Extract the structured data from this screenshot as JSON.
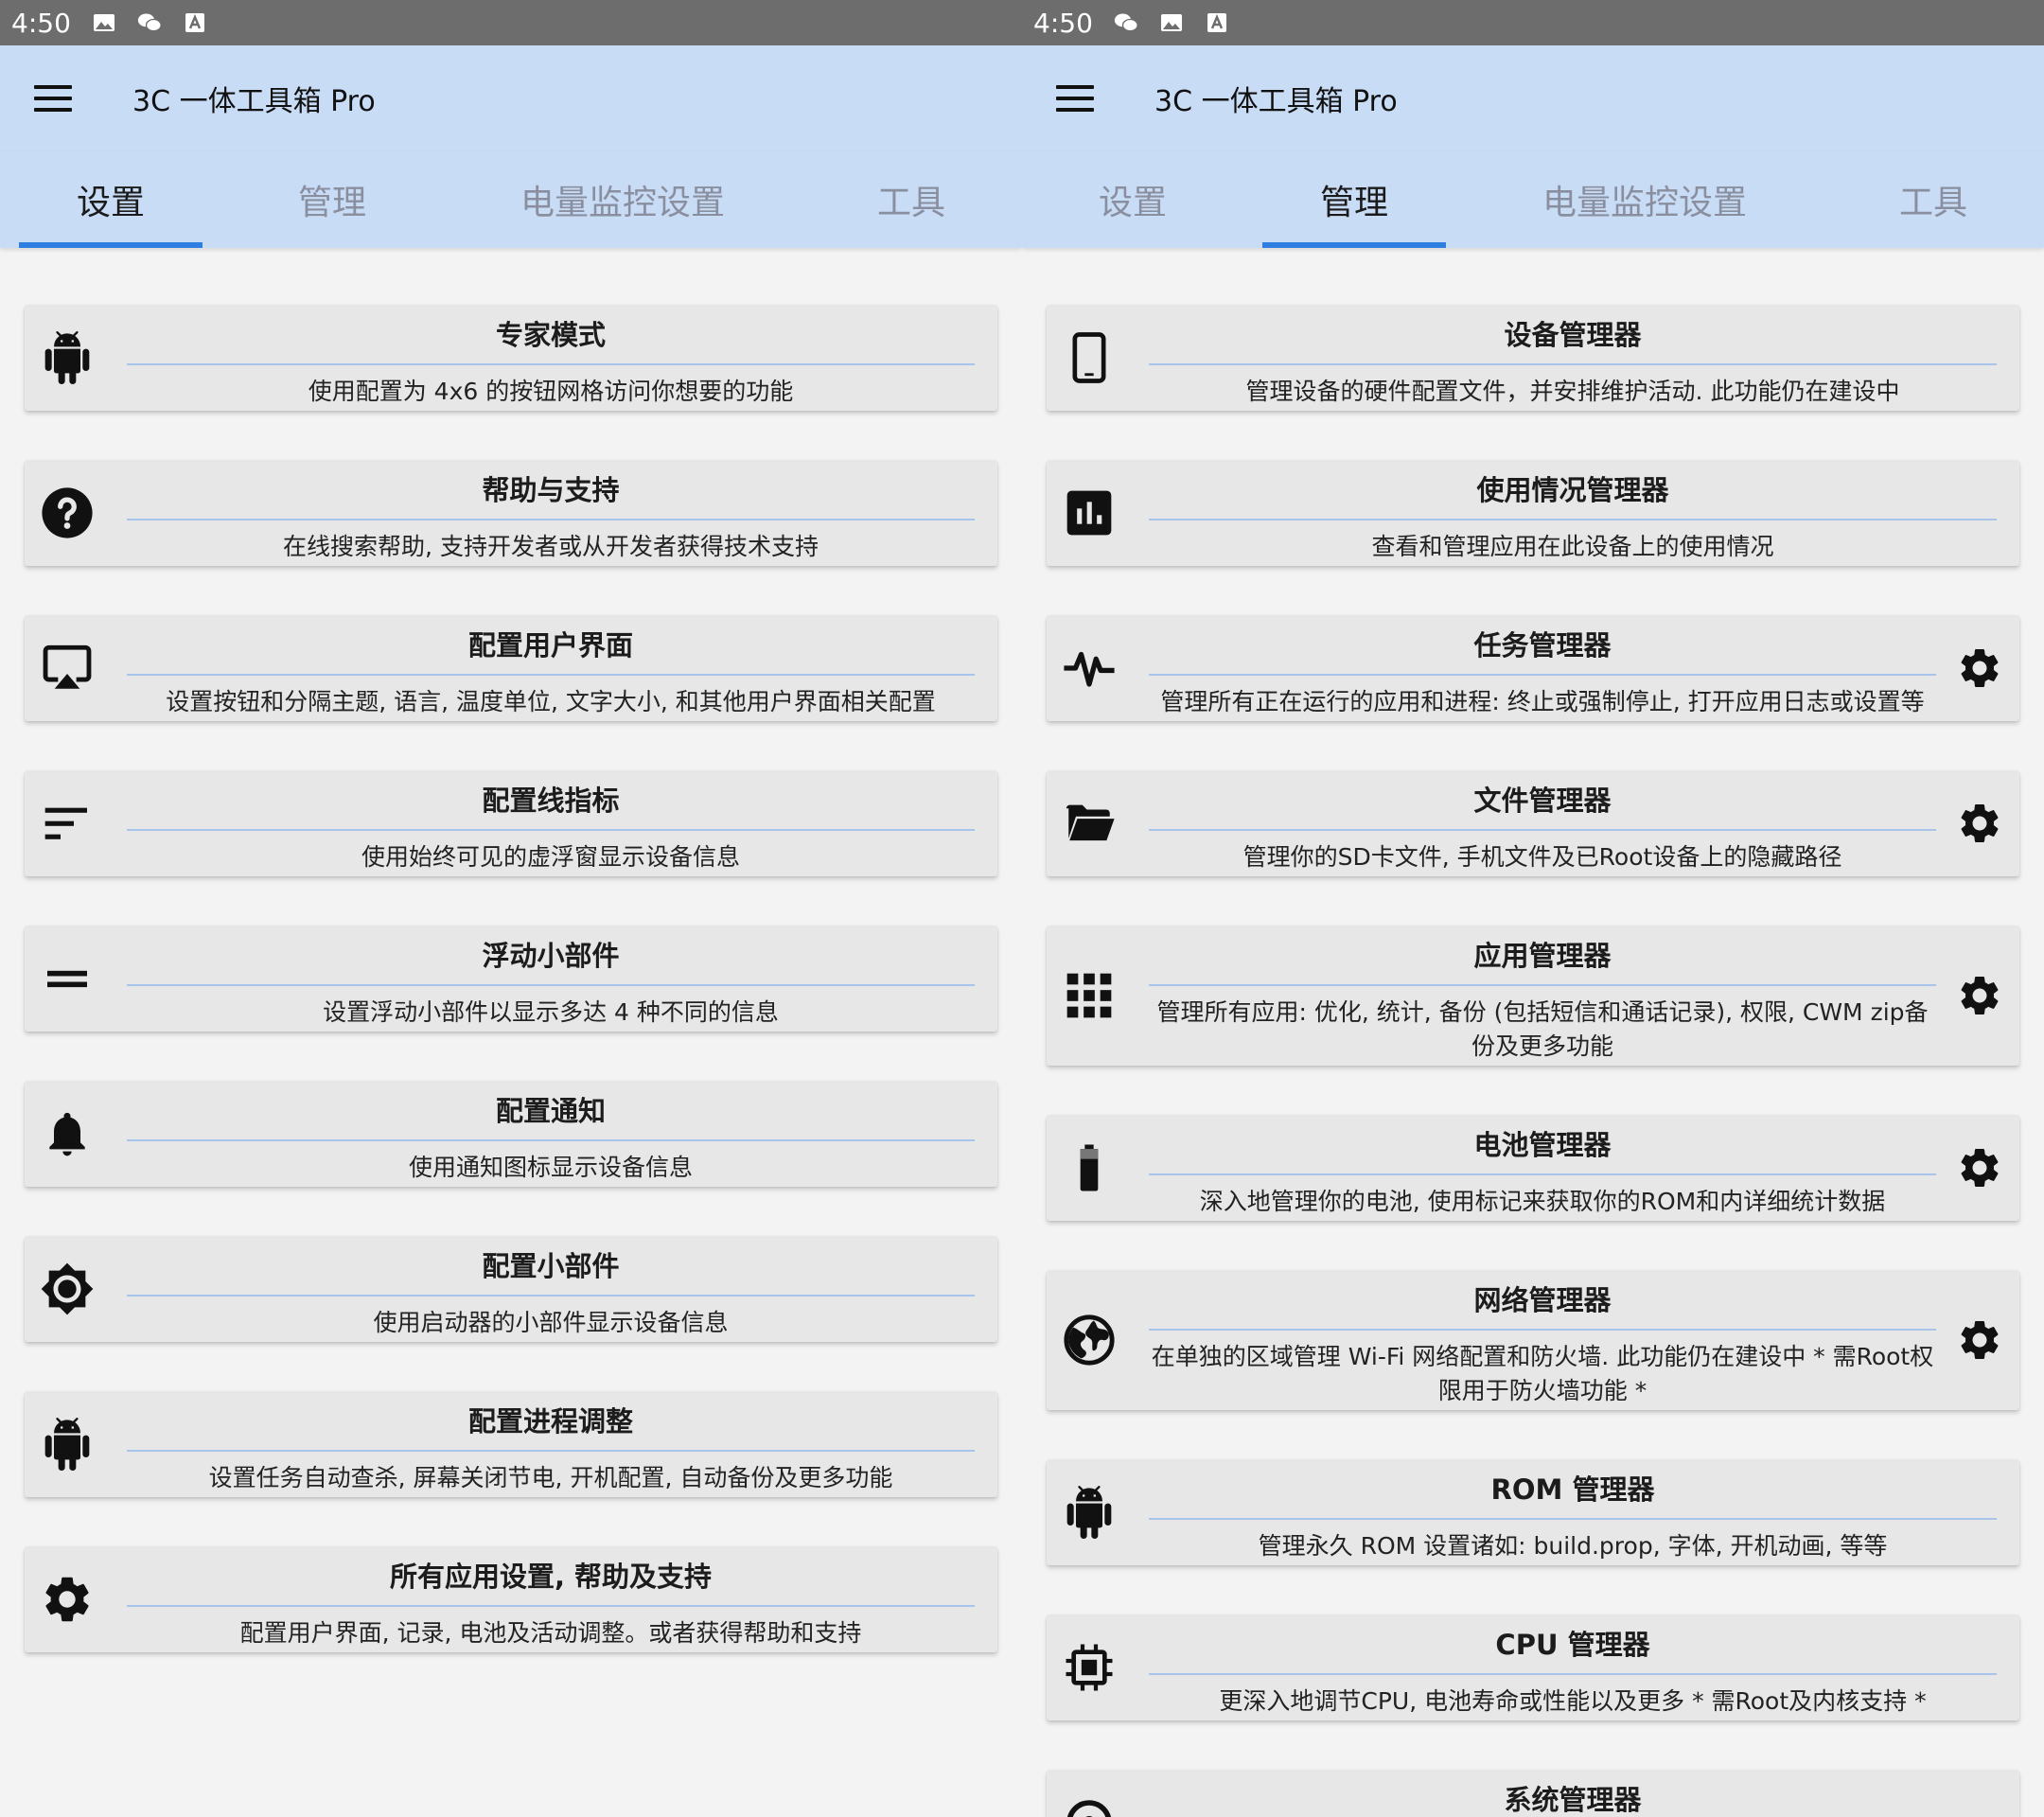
{
  "left": {
    "status": {
      "time": "4:50"
    },
    "appbar": {
      "title": "3C 一体工具箱 Pro"
    },
    "tabs": [
      {
        "label": "设置",
        "active": true
      },
      {
        "label": "管理",
        "active": false
      },
      {
        "label": "电量监控设置",
        "active": false
      },
      {
        "label": "工具",
        "active": false
      }
    ],
    "items": [
      {
        "icon": "android-icon",
        "title": "专家模式",
        "desc": "使用配置为 4x6 的按钮网格访问你想要的功能"
      },
      {
        "icon": "help-icon",
        "title": "帮助与支持",
        "desc": "在线搜索帮助, 支持开发者或从开发者获得技术支持"
      },
      {
        "icon": "cast-screen-icon",
        "title": "配置用户界面",
        "desc": "设置按钮和分隔主题, 语言, 温度单位, 文字大小, 和其他用户界面相关配置"
      },
      {
        "icon": "sort-lines-icon",
        "title": "配置线指标",
        "desc": "使用始终可见的虚浮窗显示设备信息"
      },
      {
        "icon": "equals-icon",
        "title": "浮动小部件",
        "desc": "设置浮动小部件以显示多达 4 种不同的信息"
      },
      {
        "icon": "bell-icon",
        "title": "配置通知",
        "desc": "使用通知图标显示设备信息"
      },
      {
        "icon": "brightness-icon",
        "title": "配置小部件",
        "desc": "使用启动器的小部件显示设备信息"
      },
      {
        "icon": "android-icon",
        "title": "配置进程调整",
        "desc": "设置任务自动查杀, 屏幕关闭节电, 开机配置, 自动备份及更多功能"
      },
      {
        "icon": "gear-icon",
        "title": "所有应用设置, 帮助及支持",
        "desc": "配置用户界面, 记录, 电池及活动调整。或者获得帮助和支持"
      }
    ]
  },
  "right": {
    "status": {
      "time": "4:50"
    },
    "appbar": {
      "title": "3C 一体工具箱 Pro"
    },
    "tabs": [
      {
        "label": "设置",
        "active": false
      },
      {
        "label": "管理",
        "active": true
      },
      {
        "label": "电量监控设置",
        "active": false
      },
      {
        "label": "工具",
        "active": false
      }
    ],
    "items": [
      {
        "icon": "phone-icon",
        "title": "设备管理器",
        "desc": "管理设备的硬件配置文件，并安排维护活动. 此功能仍在建设中",
        "gear": false
      },
      {
        "icon": "bar-chart-icon",
        "title": "使用情况管理器",
        "desc": "查看和管理应用在此设备上的使用情况",
        "gear": false
      },
      {
        "icon": "pulse-icon",
        "title": "任务管理器",
        "desc": "管理所有正在运行的应用和进程: 终止或强制停止, 打开应用日志或设置等",
        "gear": true
      },
      {
        "icon": "folder-open-icon",
        "title": "文件管理器",
        "desc": "管理你的SD卡文件, 手机文件及已Root设备上的隐藏路径",
        "gear": true
      },
      {
        "icon": "apps-grid-icon",
        "title": "应用管理器",
        "desc": "管理所有应用: 优化, 统计, 备份 (包括短信和通话记录), 权限, CWM zip备份及更多功能",
        "gear": true
      },
      {
        "icon": "battery-icon",
        "title": "电池管理器",
        "desc": "深入地管理你的电池, 使用标记来获取你的ROM和内详细统计数据",
        "gear": true
      },
      {
        "icon": "globe-icon",
        "title": "网络管理器",
        "desc": "在单独的区域管理 Wi-Fi 网络配置和防火墙. 此功能仍在建设中 * 需Root权限用于防火墙功能 *",
        "gear": true
      },
      {
        "icon": "android-icon",
        "title": "ROM 管理器",
        "desc": "管理永久 ROM 设置诸如: build.prop, 字体, 开机动画, 等等",
        "gear": false
      },
      {
        "icon": "cpu-chip-icon",
        "title": "CPU 管理器",
        "desc": "更深入地调节CPU, 电池寿命或性能以及更多 * 需Root及内核支持 *",
        "gear": false
      },
      {
        "icon": "system-icon",
        "title": "系统管理器",
        "desc": "",
        "gear": false
      }
    ]
  },
  "colors": {
    "appbar": "#c9dcf6",
    "status_bar": "#6d6d6d",
    "tab_indicator": "#2f7fe0",
    "card": "#e7e7e7",
    "divider": "#a9c4ea"
  }
}
